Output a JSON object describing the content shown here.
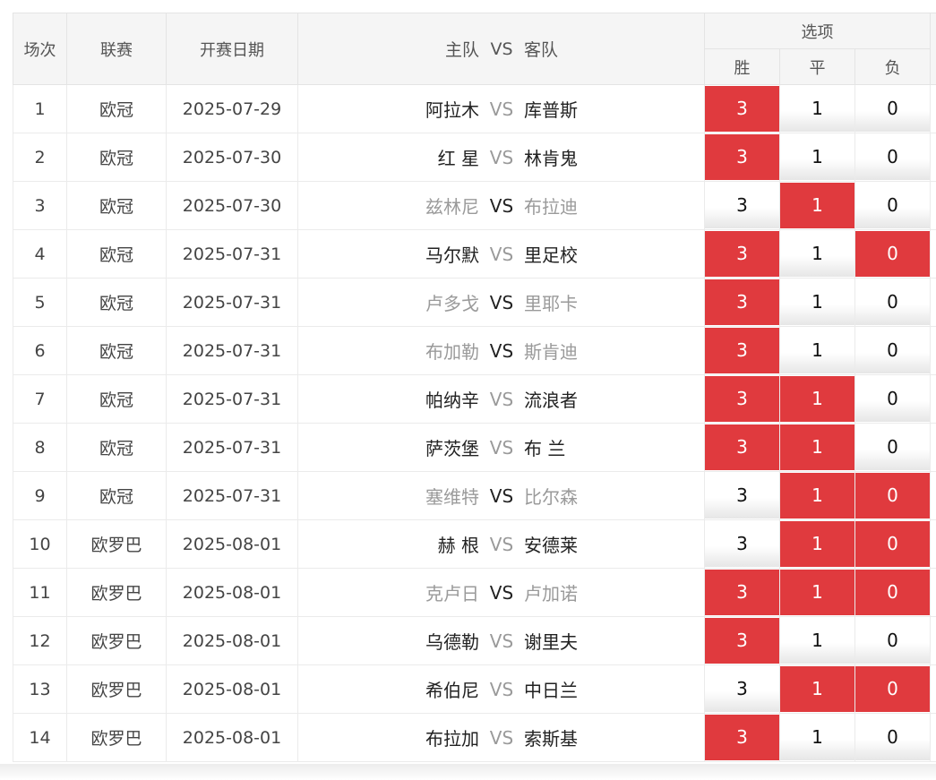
{
  "header": {
    "col_index": "场次",
    "col_league": "联赛",
    "col_date": "开赛日期",
    "col_home": "主队",
    "col_vs": "VS",
    "col_away": "客队",
    "col_options": "选项",
    "opt_win": "胜",
    "opt_draw": "平",
    "opt_loss": "负"
  },
  "colors": {
    "selected": "#e03a3e",
    "header_bg": "#f5f5f5",
    "muted_text": "#9a9a9a"
  },
  "rows": [
    {
      "idx": "1",
      "league": "欧冠",
      "date": "2025-07-29",
      "home": "阿拉木",
      "vs": "VS",
      "away": "库普斯",
      "muted": false,
      "win": "3",
      "draw": "1",
      "loss": "0",
      "sel": [
        true,
        false,
        false
      ]
    },
    {
      "idx": "2",
      "league": "欧冠",
      "date": "2025-07-30",
      "home": "红 星",
      "vs": "VS",
      "away": "林肯鬼",
      "muted": false,
      "win": "3",
      "draw": "1",
      "loss": "0",
      "sel": [
        true,
        false,
        false
      ]
    },
    {
      "idx": "3",
      "league": "欧冠",
      "date": "2025-07-30",
      "home": "兹林尼",
      "vs": "VS",
      "away": "布拉迪",
      "muted": true,
      "win": "3",
      "draw": "1",
      "loss": "0",
      "sel": [
        false,
        true,
        false
      ]
    },
    {
      "idx": "4",
      "league": "欧冠",
      "date": "2025-07-31",
      "home": "马尔默",
      "vs": "VS",
      "away": "里足校",
      "muted": false,
      "win": "3",
      "draw": "1",
      "loss": "0",
      "sel": [
        true,
        false,
        true
      ]
    },
    {
      "idx": "5",
      "league": "欧冠",
      "date": "2025-07-31",
      "home": "卢多戈",
      "vs": "VS",
      "away": "里耶卡",
      "muted": true,
      "win": "3",
      "draw": "1",
      "loss": "0",
      "sel": [
        true,
        false,
        false
      ]
    },
    {
      "idx": "6",
      "league": "欧冠",
      "date": "2025-07-31",
      "home": "布加勒",
      "vs": "VS",
      "away": "斯肯迪",
      "muted": true,
      "win": "3",
      "draw": "1",
      "loss": "0",
      "sel": [
        true,
        false,
        false
      ]
    },
    {
      "idx": "7",
      "league": "欧冠",
      "date": "2025-07-31",
      "home": "帕纳辛",
      "vs": "VS",
      "away": "流浪者",
      "muted": false,
      "win": "3",
      "draw": "1",
      "loss": "0",
      "sel": [
        true,
        true,
        false
      ]
    },
    {
      "idx": "8",
      "league": "欧冠",
      "date": "2025-07-31",
      "home": "萨茨堡",
      "vs": "VS",
      "away": "布 兰",
      "muted": false,
      "win": "3",
      "draw": "1",
      "loss": "0",
      "sel": [
        true,
        true,
        false
      ]
    },
    {
      "idx": "9",
      "league": "欧冠",
      "date": "2025-07-31",
      "home": "塞维特",
      "vs": "VS",
      "away": "比尔森",
      "muted": true,
      "win": "3",
      "draw": "1",
      "loss": "0",
      "sel": [
        false,
        true,
        true
      ]
    },
    {
      "idx": "10",
      "league": "欧罗巴",
      "date": "2025-08-01",
      "home": "赫 根",
      "vs": "VS",
      "away": "安德莱",
      "muted": false,
      "win": "3",
      "draw": "1",
      "loss": "0",
      "sel": [
        false,
        true,
        true
      ]
    },
    {
      "idx": "11",
      "league": "欧罗巴",
      "date": "2025-08-01",
      "home": "克卢日",
      "vs": "VS",
      "away": "卢加诺",
      "muted": true,
      "win": "3",
      "draw": "1",
      "loss": "0",
      "sel": [
        true,
        true,
        true
      ]
    },
    {
      "idx": "12",
      "league": "欧罗巴",
      "date": "2025-08-01",
      "home": "乌德勒",
      "vs": "VS",
      "away": "谢里夫",
      "muted": false,
      "win": "3",
      "draw": "1",
      "loss": "0",
      "sel": [
        true,
        false,
        false
      ]
    },
    {
      "idx": "13",
      "league": "欧罗巴",
      "date": "2025-08-01",
      "home": "希伯尼",
      "vs": "VS",
      "away": "中日兰",
      "muted": false,
      "win": "3",
      "draw": "1",
      "loss": "0",
      "sel": [
        false,
        true,
        true
      ]
    },
    {
      "idx": "14",
      "league": "欧罗巴",
      "date": "2025-08-01",
      "home": "布拉加",
      "vs": "VS",
      "away": "索斯基",
      "muted": false,
      "win": "3",
      "draw": "1",
      "loss": "0",
      "sel": [
        true,
        false,
        false
      ]
    }
  ]
}
